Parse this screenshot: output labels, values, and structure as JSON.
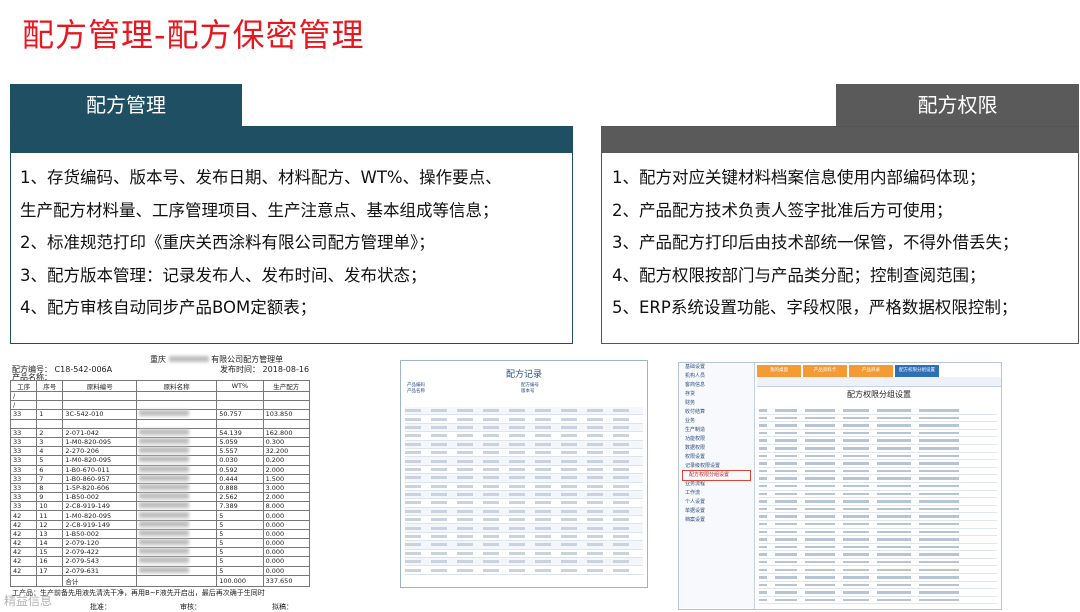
{
  "slide": {
    "title": "配方管理-配方保密管理"
  },
  "left_panel": {
    "tab": "配方管理",
    "lines": [
      "1、存货编码、版本号、发布日期、材料配方、WT%、操作要点、",
      "生产配方材料量、工序管理项目、生产注意点、基本组成等信息；",
      "2、标准规范打印《重庆关西涂料有限公司配方管理单》；",
      "3、配方版本管理：记录发布人、发布时间、发布状态；",
      "4、配方审核自动同步产品BOM定额表；"
    ]
  },
  "right_panel": {
    "tab": "配方权限",
    "lines": [
      "1、配方对应关键材料档案信息使用内部编码体现；",
      "2、产品配方技术负责人签字批准后方可使用；",
      "3、产品配方打印后由技术部统一保管，不得外借丢失；",
      "4、配方权限按部门与产品类分配；控制查阅范围；",
      "5、ERP系统设置功能、字段权限，严格数据权限控制；"
    ]
  },
  "doc_shot": {
    "company": "重庆",
    "company_tail": "有限公司配方管理单",
    "code_label": "配方编号：",
    "code_value": "C18-542-006A",
    "name_label": "产品名称：",
    "date_label": "发布时间：",
    "date_value": "2018-08-16",
    "headers": [
      "工序",
      "序号",
      "原料编号",
      "原料名称",
      "WT%",
      "生产配方"
    ],
    "rows": [
      [
        "/",
        "",
        "",
        "",
        "",
        ""
      ],
      [
        "/",
        "",
        "",
        "",
        "",
        ""
      ],
      [
        "33",
        "1",
        "3C-542-010",
        "",
        "50.757",
        "103.850"
      ],
      [
        "",
        "",
        "",
        "",
        "",
        ""
      ],
      [
        "33",
        "2",
        "2-071-042",
        "",
        "54.139",
        "162.800"
      ],
      [
        "33",
        "3",
        "1-M0-820-095",
        "",
        "5.059",
        "0.300"
      ],
      [
        "33",
        "4",
        "2-270-206",
        "",
        "5.557",
        "32.200"
      ],
      [
        "33",
        "5",
        "1-M0-820-095",
        "",
        "0.030",
        "0.200"
      ],
      [
        "33",
        "6",
        "1-B0-670-011",
        "",
        "0.592",
        "2.000"
      ],
      [
        "33",
        "7",
        "1-B0-860-957",
        "",
        "0.444",
        "1.500"
      ],
      [
        "33",
        "8",
        "1-5P-820-606",
        "",
        "0.888",
        "3.000"
      ],
      [
        "33",
        "9",
        "1-B50-002",
        "",
        "2.562",
        "2.000"
      ],
      [
        "33",
        "10",
        "2-C8-919-149",
        "",
        "7.389",
        "8.000"
      ],
      [
        "42",
        "11",
        "1-M0-820-095",
        "",
        "5",
        "0.000"
      ],
      [
        "42",
        "12",
        "2-C8-919-149",
        "",
        "5",
        "0.000"
      ],
      [
        "42",
        "13",
        "1-B50-002",
        "",
        "5",
        "0.000"
      ],
      [
        "42",
        "14",
        "2-079-120",
        "",
        "5",
        "0.000"
      ],
      [
        "42",
        "15",
        "2-079-422",
        "",
        "5",
        "0.000"
      ],
      [
        "42",
        "16",
        "2-079-543",
        "",
        "5",
        "0.000"
      ],
      [
        "42",
        "17",
        "2-079-631",
        "",
        "5",
        "0.000"
      ]
    ],
    "total_label": "合计",
    "total_wt": "100.000",
    "total_prod": "337.650",
    "footer_note": "工产品：生产前备先用液先清洗干净，再用B~F液先开启出，最后再次确于生同时",
    "approver_label": "批准：",
    "reviewer_label": "审核：",
    "maker_label": "拟稿："
  },
  "grid_shot": {
    "title": "配方记录",
    "header_fields": [
      "产品编码",
      "产品名称",
      "配方编号",
      "版本号"
    ]
  },
  "erp_shot": {
    "heading": "配方权限分组设置",
    "nav": [
      "基础设置",
      "机构人员",
      "客商信息",
      "存货",
      "财务",
      "收付结算",
      "业务",
      "生产制造",
      "功能权限",
      "数据权限",
      "权限设置",
      "记录级权限设置",
      "配方权限分组设置",
      "业务流程",
      "工作流",
      "个人设置",
      "单据设置",
      "档案设置"
    ],
    "tabs": [
      "我的桌面",
      "产品资料卡",
      "产品目录",
      "配方权限分组设置"
    ],
    "active_nav_index": 12
  },
  "watermark": "精益信息"
}
